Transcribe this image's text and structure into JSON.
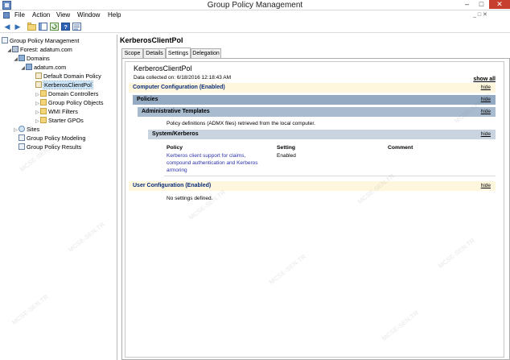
{
  "window": {
    "title": "Group Policy Management",
    "min_glyph": "–",
    "max_glyph": "□",
    "close_glyph": "✕"
  },
  "menu": {
    "items": [
      "File",
      "Action",
      "View",
      "Window",
      "Help"
    ],
    "restore_glyph": "_ □ ✕"
  },
  "toolbar": {
    "buttons": [
      "back",
      "forward",
      "up-folder",
      "show-hide-tree",
      "refresh",
      "help",
      "properties"
    ]
  },
  "tree": {
    "root": "Group Policy Management",
    "forest": "Forest: adatum.com",
    "domains": "Domains",
    "domain": "adatum.com",
    "default_policy": "Default Domain Policy",
    "selected_gpo": "KerberosClientPol",
    "domain_controllers": "Domain Controllers",
    "gpo_folder": "Group Policy Objects",
    "wmi_filters": "WMI Filters",
    "starter_gpos": "Starter GPOs",
    "sites": "Sites",
    "modeling": "Group Policy Modeling",
    "results": "Group Policy Results"
  },
  "main": {
    "header": "KerberosClientPol",
    "tabs": [
      "Scope",
      "Details",
      "Settings",
      "Delegation"
    ],
    "active_tab": "Settings",
    "report": {
      "title": "KerberosClientPol",
      "date": "Data collected on: 6/18/2016 12:18:43 AM",
      "show_all": "show all",
      "hide": "hide",
      "computer_config": "Computer Configuration (Enabled)",
      "policies": "Policies",
      "admin_templates": "Administrative Templates",
      "admx_note": "Policy definitions (ADMX files) retrieved from the local computer.",
      "system_kerberos": "System/Kerberos",
      "col_policy": "Policy",
      "col_setting": "Setting",
      "col_comment": "Comment",
      "policy_line1": "Kerberos client support for claims,",
      "policy_line2": "compound authentication and Kerberos",
      "policy_line3": "armoring",
      "policy_setting": "Enabled",
      "user_config": "User Configuration (Enabled)",
      "no_settings": "No settings defined."
    }
  },
  "colors": {
    "yellow_band": "#fef7de",
    "dark_band": "#94aac2",
    "mid_band": "#a9bbcf",
    "light_band": "#c9d4e0",
    "link": "#2a31a8",
    "close_button": "#c7402f"
  }
}
